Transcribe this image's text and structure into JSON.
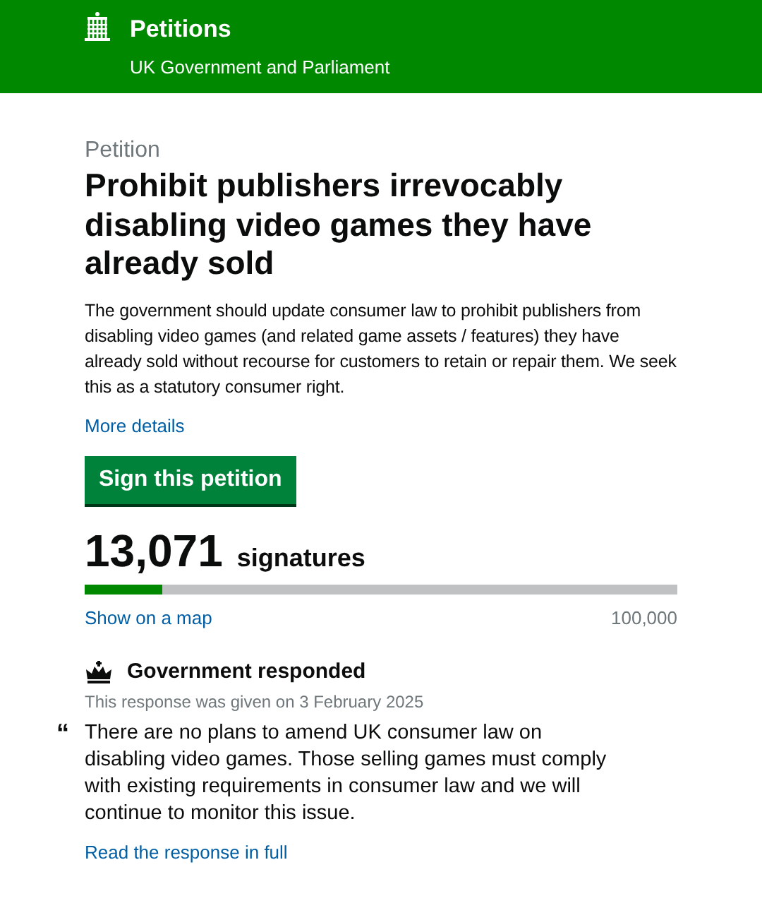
{
  "header": {
    "title": "Petitions",
    "subtitle": "UK Government and Parliament"
  },
  "petition": {
    "label": "Petition",
    "title": "Prohibit publishers irrevocably disabling video games they have already sold",
    "description": "The government should update consumer law to prohibit publishers from disabling video games (and related game assets / features) they have already sold without recourse for customers to retain or repair them. We seek this as a statutory consumer right.",
    "more_link": "More details",
    "sign_button": "Sign this petition"
  },
  "signatures": {
    "count": "13,071",
    "label": "signatures",
    "level": 0.131,
    "map_link": "Show on a map",
    "target": "100,000"
  },
  "response": {
    "heading": "Government responded",
    "date_note": "This response was given on 3 February 2025",
    "quote_mark": "“",
    "quote": "There are no plans to amend UK consumer law on disabling video games. Those selling games must comply with existing requirements in consumer law and we will continue to monitor this issue.",
    "full_link": "Read the response in full"
  }
}
